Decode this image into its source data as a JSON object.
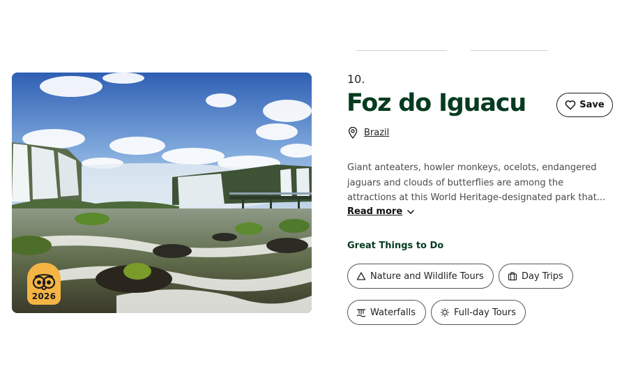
{
  "destination": {
    "rank": "10.",
    "name": "Foz do Iguacu",
    "country": "Brazil",
    "description_lines": [
      "Giant anteaters, howler monkeys, ocelots, endangered",
      "jaguars and clouds of butterflies are among the",
      "attractions at this World Heritage-designated park that..."
    ],
    "read_more": "Read more",
    "save_label": "Save",
    "award_year": "2026"
  },
  "things_to_do": {
    "title": "Great Things to Do",
    "chips": [
      {
        "label": "Nature and Wildlife Tours",
        "icon": "triangle-icon"
      },
      {
        "label": "Day Trips",
        "icon": "suitcase-icon"
      },
      {
        "label": "Waterfalls",
        "icon": "waterfall-icon"
      },
      {
        "label": "Full-day Tours",
        "icon": "sun-icon"
      }
    ]
  },
  "colors": {
    "title_green": "#073b1f",
    "award_orange": "#f5b545"
  }
}
